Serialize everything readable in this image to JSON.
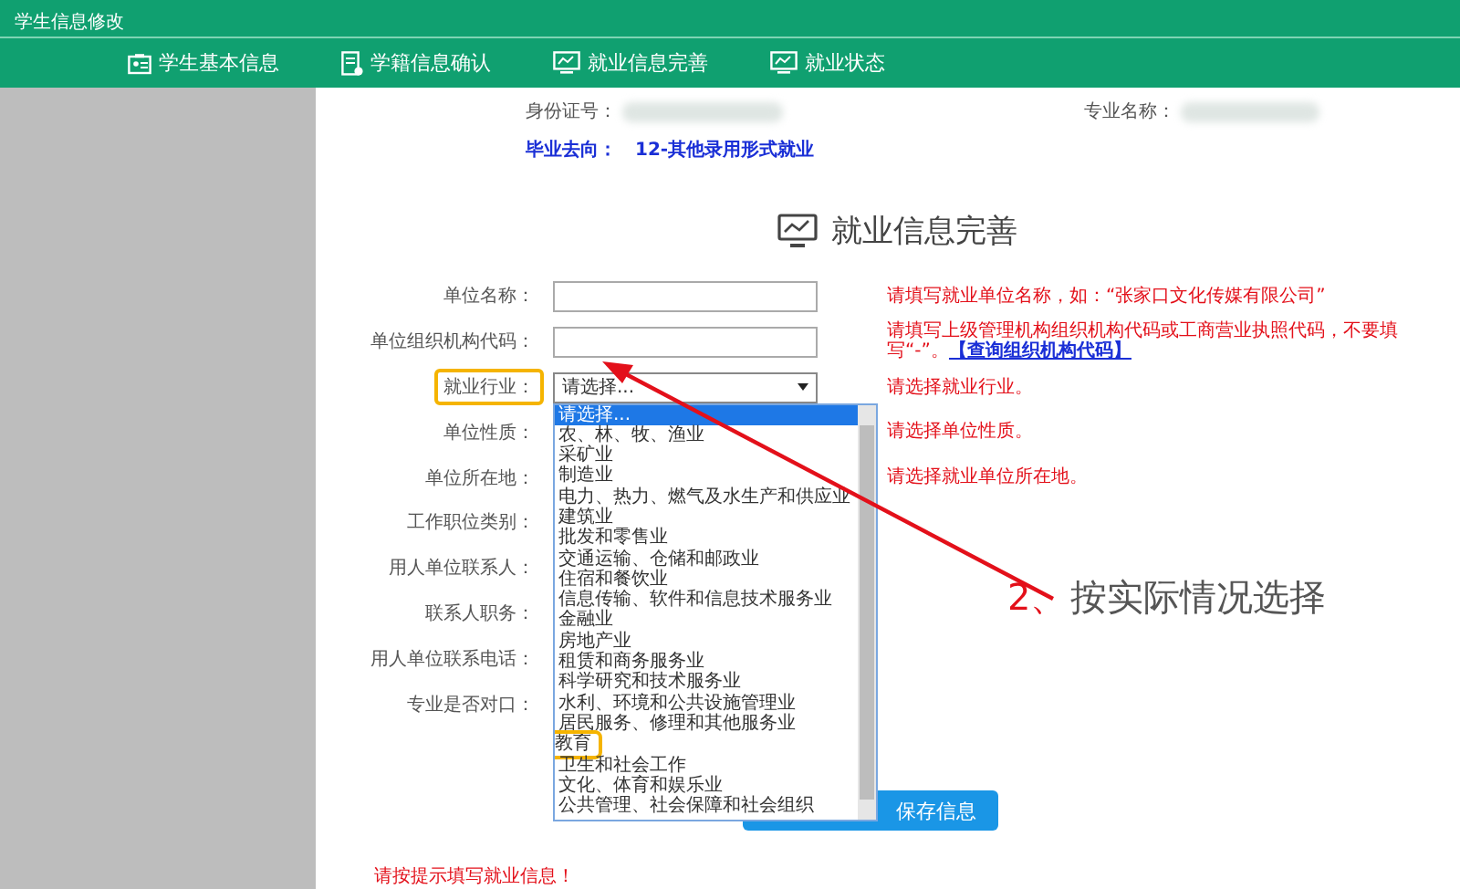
{
  "window": {
    "title": "学生信息修改"
  },
  "nav": {
    "tabs": [
      {
        "label": "学生基本信息",
        "kind": "id-card"
      },
      {
        "label": "学籍信息确认",
        "kind": "document"
      },
      {
        "label": "就业信息完善",
        "kind": "monitor"
      },
      {
        "label": "就业状态",
        "kind": "monitor"
      }
    ]
  },
  "summary": {
    "id_label": "身份证号：",
    "major_label": "专业名称：",
    "destination_label": "毕业去向：",
    "destination_value": "12-其他录用形式就业"
  },
  "form": {
    "title": "就业信息完善",
    "fields": [
      {
        "label": "单位名称：",
        "kind": "text",
        "outlined": false,
        "hint": "请填写就业单位名称，如：“张家口文化传媒有限公司”"
      },
      {
        "label": "单位组织机构代码：",
        "kind": "text",
        "outlined": false,
        "hint": "请填写上级管理机构组织机构代码或工商营业执照代码，不要填写“-”。",
        "link": "【查询组织机构代码】"
      },
      {
        "label": "就业行业：",
        "kind": "select",
        "outlined": true,
        "value": "请选择...",
        "hint": "请选择就业行业。"
      },
      {
        "label": "单位性质：",
        "kind": "none",
        "outlined": false,
        "hint": "请选择单位性质。"
      },
      {
        "label": "单位所在地：",
        "kind": "none",
        "outlined": false,
        "hint": "请选择就业单位所在地。"
      },
      {
        "label": "工作职位类别：",
        "kind": "none",
        "outlined": false
      },
      {
        "label": "用人单位联系人：",
        "kind": "none",
        "outlined": false
      },
      {
        "label": "联系人职务：",
        "kind": "none",
        "outlined": false
      },
      {
        "label": "用人单位联系电话：",
        "kind": "none",
        "outlined": false
      },
      {
        "label": "专业是否对口：",
        "kind": "none",
        "outlined": false
      }
    ],
    "dropdown": {
      "options": [
        {
          "label": "请选择...",
          "selected": true,
          "outlined": false
        },
        {
          "label": "农、林、牧、渔业",
          "selected": false,
          "outlined": false
        },
        {
          "label": "采矿业",
          "selected": false,
          "outlined": false
        },
        {
          "label": "制造业",
          "selected": false,
          "outlined": false
        },
        {
          "label": "电力、热力、燃气及水生产和供应业",
          "selected": false,
          "outlined": false
        },
        {
          "label": "建筑业",
          "selected": false,
          "outlined": false
        },
        {
          "label": "批发和零售业",
          "selected": false,
          "outlined": false
        },
        {
          "label": "交通运输、仓储和邮政业",
          "selected": false,
          "outlined": false
        },
        {
          "label": "住宿和餐饮业",
          "selected": false,
          "outlined": false
        },
        {
          "label": "信息传输、软件和信息技术服务业",
          "selected": false,
          "outlined": false
        },
        {
          "label": "金融业",
          "selected": false,
          "outlined": false
        },
        {
          "label": "房地产业",
          "selected": false,
          "outlined": false
        },
        {
          "label": "租赁和商务服务业",
          "selected": false,
          "outlined": false
        },
        {
          "label": "科学研究和技术服务业",
          "selected": false,
          "outlined": false
        },
        {
          "label": "水利、环境和公共设施管理业",
          "selected": false,
          "outlined": false
        },
        {
          "label": "居民服务、修理和其他服务业",
          "selected": false,
          "outlined": false
        },
        {
          "label": "教育",
          "selected": false,
          "outlined": true
        },
        {
          "label": "卫生和社会工作",
          "selected": false,
          "outlined": false
        },
        {
          "label": "文化、体育和娱乐业",
          "selected": false,
          "outlined": false
        },
        {
          "label": "公共管理、社会保障和社会组织",
          "selected": false,
          "outlined": false
        }
      ]
    },
    "save_button": "保存信息",
    "message": "请按提示填写就业信息！"
  },
  "annotation": {
    "step": "2、",
    "text": "按实际情况选择"
  }
}
